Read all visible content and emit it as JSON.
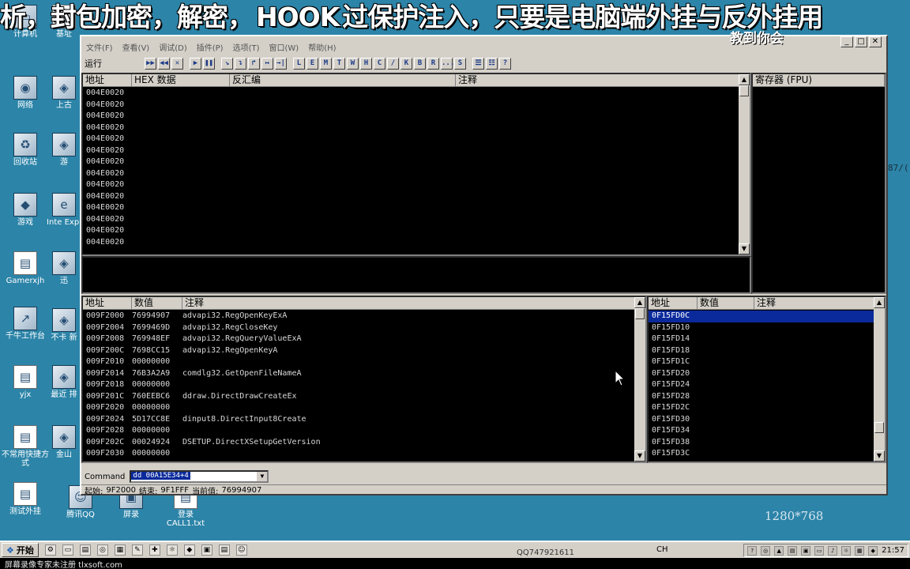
{
  "banner": {
    "left": "析，封包加密，解密，",
    "hook": "HOOK",
    "right": "过保护注入，只要是电脑端外挂与反外挂用",
    "sub": "教到你会"
  },
  "desktop_icons": [
    {
      "label": "计算机",
      "icon": "computer-icon"
    },
    {
      "label": "网络",
      "icon": "network-icon"
    },
    {
      "label": "回收站",
      "icon": "recycle-bin-icon"
    },
    {
      "label": "游戏",
      "icon": "game-icon"
    },
    {
      "label": "Gamerxjh",
      "icon": "file-icon"
    },
    {
      "label": "千牛工作台",
      "icon": "app-icon"
    },
    {
      "label": "yjx",
      "icon": "file-icon"
    },
    {
      "label": "不常用快捷方式",
      "icon": "folder-icon"
    },
    {
      "label": "测试外挂",
      "icon": "file-icon"
    }
  ],
  "desktop_icons_col2": [
    {
      "label": "基址",
      "icon": "file-icon"
    },
    {
      "label": "上古",
      "icon": "app-icon"
    },
    {
      "label": "游",
      "icon": "app-icon"
    },
    {
      "label": "Inte Expl",
      "icon": "ie-icon"
    },
    {
      "label": "迅",
      "icon": "app-icon"
    },
    {
      "label": "不卡 新",
      "icon": "app-icon"
    },
    {
      "label": "最近 排",
      "icon": "app-icon"
    },
    {
      "label": "金山",
      "icon": "app-icon"
    },
    {
      "label": "腾讯QQ",
      "icon": "qq-icon"
    },
    {
      "label": "屏录",
      "icon": "app-icon"
    },
    {
      "label": "登录 CALL1.txt",
      "icon": "text-file-icon"
    }
  ],
  "window": {
    "menu": [
      "文件(F)",
      "查看(V)",
      "调试(D)",
      "插件(P)",
      "选项(T)",
      "窗口(W)",
      "帮助(H)"
    ],
    "toolbar_label": "运行",
    "toolbar_buttons": [
      "▶▶",
      "◀◀",
      "✕",
      "▶",
      "❚❚",
      "↘",
      "↴",
      "↱",
      "↦",
      "→|",
      "L",
      "E",
      "M",
      "T",
      "W",
      "H",
      "C",
      "/",
      "K",
      "B",
      "R",
      "...",
      "S",
      "☰",
      "☷",
      "?"
    ],
    "cpu": {
      "headers": [
        "地址",
        "HEX 数据",
        "反汇编",
        "注释"
      ],
      "rows": [
        "004E0020",
        "004E0020",
        "004E0020",
        "004E0020",
        "004E0020",
        "004E0020",
        "004E0020",
        "004E0020",
        "004E0020",
        "004E0020",
        "004E0020",
        "004E0020",
        "004E0020",
        "004E0020"
      ]
    },
    "registers": {
      "header": "寄存器 (FPU)"
    },
    "dump": {
      "headers": [
        "地址",
        "数值",
        "注释"
      ],
      "rows": [
        {
          "addr": "009F2000",
          "val": "76994907",
          "note": "advapi32.RegOpenKeyExA"
        },
        {
          "addr": "009F2004",
          "val": "7699469D",
          "note": "advapi32.RegCloseKey"
        },
        {
          "addr": "009F2008",
          "val": "769948EF",
          "note": "advapi32.RegQueryValueExA"
        },
        {
          "addr": "009F200C",
          "val": "7698CC15",
          "note": "advapi32.RegOpenKeyA"
        },
        {
          "addr": "009F2010",
          "val": "00000000",
          "note": ""
        },
        {
          "addr": "009F2014",
          "val": "76B3A2A9",
          "note": "comdlg32.GetOpenFileNameA"
        },
        {
          "addr": "009F2018",
          "val": "00000000",
          "note": ""
        },
        {
          "addr": "009F201C",
          "val": "760EEBC6",
          "note": "ddraw.DirectDrawCreateEx"
        },
        {
          "addr": "009F2020",
          "val": "00000000",
          "note": ""
        },
        {
          "addr": "009F2024",
          "val": "5D17CC8E",
          "note": "dinput8.DirectInput8Create"
        },
        {
          "addr": "009F2028",
          "val": "00000000",
          "note": ""
        },
        {
          "addr": "009F202C",
          "val": "00024924",
          "note": "DSETUP.DirectXSetupGetVersion"
        },
        {
          "addr": "009F2030",
          "val": "00000000",
          "note": ""
        }
      ]
    },
    "stack": {
      "headers": [
        "地址",
        "数值",
        "注释"
      ],
      "rows": [
        "0F15FD0C",
        "0F15FD10",
        "0F15FD14",
        "0F15FD18",
        "0F15FD1C",
        "0F15FD20",
        "0F15FD24",
        "0F15FD28",
        "0F15FD2C",
        "0F15FD30",
        "0F15FD34",
        "0F15FD38",
        "0F15FD3C"
      ]
    },
    "command": {
      "label": "Command",
      "value": "dd 00A15E34+4"
    },
    "status": {
      "start_label": "起始:",
      "start": "9F2000",
      "end_label": "结束:",
      "end": "9F1FFF",
      "current_label": "当前值:",
      "current": "76994907"
    }
  },
  "resolution": "1280*768",
  "side_text": "87/(",
  "taskbar": {
    "start": "开始",
    "ime": "CH",
    "clock": "21:57",
    "qq": "QQ747921611",
    "watermark": "屏幕录像专家未注册 tlxsoft.com"
  }
}
